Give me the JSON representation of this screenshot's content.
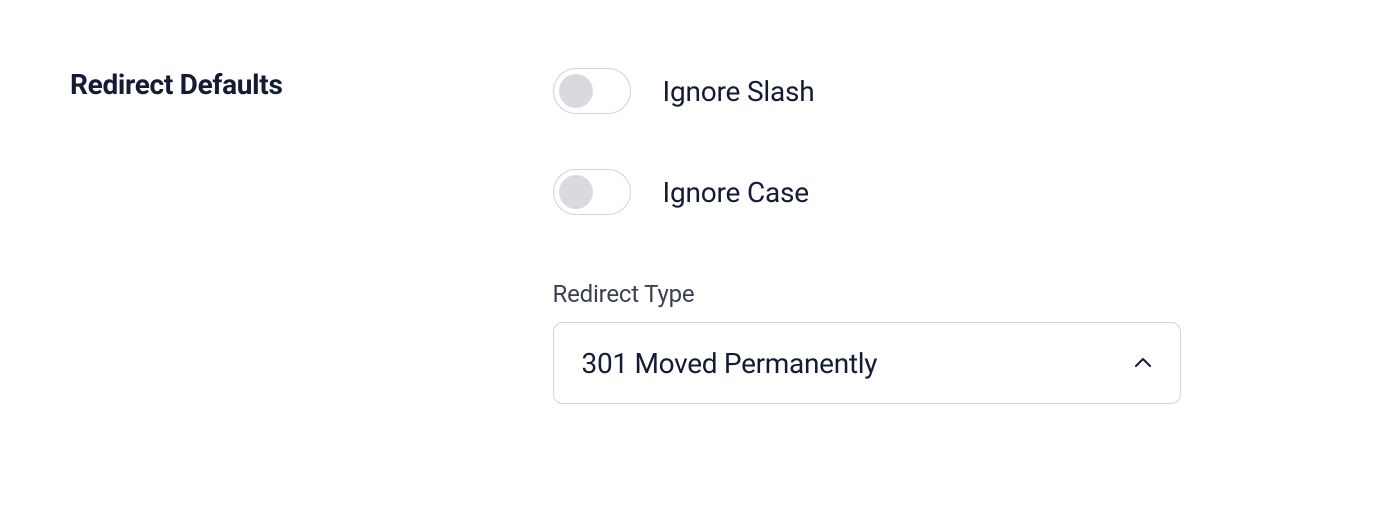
{
  "section": {
    "title": "Redirect Defaults"
  },
  "toggles": {
    "ignoreSlash": {
      "label": "Ignore Slash",
      "enabled": false
    },
    "ignoreCase": {
      "label": "Ignore Case",
      "enabled": false
    }
  },
  "select": {
    "label": "Redirect Type",
    "value": "301 Moved Permanently"
  }
}
